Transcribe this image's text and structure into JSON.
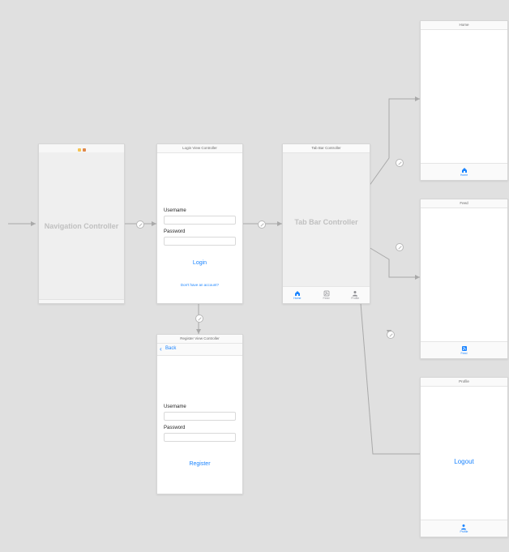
{
  "nav_controller": {
    "title": "",
    "placeholder": "Navigation Controller"
  },
  "login": {
    "title": "Login View Controller",
    "username_label": "Username",
    "password_label": "Password",
    "login_button": "Login",
    "register_link": "Don't have an account?"
  },
  "register": {
    "title": "Register View Controller",
    "back_label": "Back",
    "username_label": "Username",
    "password_label": "Password",
    "register_button": "Register"
  },
  "tabbar_controller": {
    "title": "Tab Bar Controller",
    "placeholder": "Tab Bar Controller",
    "tabs": [
      {
        "label": "Home"
      },
      {
        "label": "Feed"
      },
      {
        "label": "Profile"
      }
    ]
  },
  "home": {
    "title": "Home",
    "tab_label": "Home"
  },
  "feed": {
    "title": "Feed",
    "tab_label": "Feed"
  },
  "profile": {
    "title": "Profile",
    "logout_button": "Logout",
    "tab_label": "Profile"
  }
}
